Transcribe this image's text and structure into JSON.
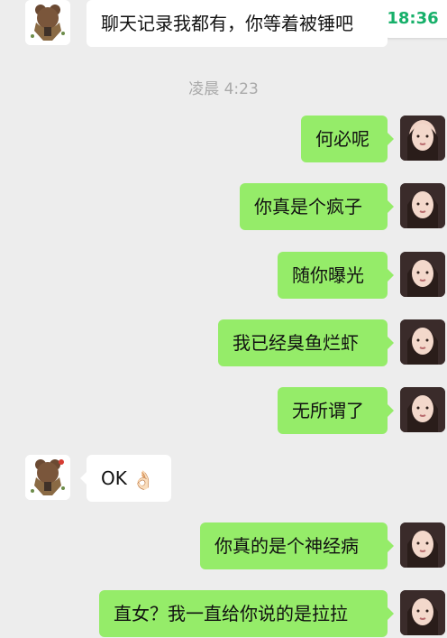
{
  "status": {
    "clock": "18:36"
  },
  "divider": {
    "time": "凌晨 4:23"
  },
  "messages": [
    {
      "text": "聊天记录我都有，你等着被锤吧"
    },
    {
      "text": "何必呢"
    },
    {
      "text": "你真是个疯子"
    },
    {
      "text": "随你曝光"
    },
    {
      "text": "我已经臭鱼烂虾"
    },
    {
      "text": "无所谓了"
    },
    {
      "text": "OK",
      "emoji": "👌🏻"
    },
    {
      "text": "你真的是个神经病"
    },
    {
      "text": "直女？我一直给你说的是拉拉"
    }
  ],
  "colors": {
    "background": "#ededed",
    "incoming_bubble": "#ffffff",
    "outgoing_bubble": "#95ec69",
    "clock_text": "#17b06a"
  },
  "icons": {
    "left_avatar": "bear-sticker-avatar",
    "right_avatar": "girl-portrait-avatar"
  }
}
